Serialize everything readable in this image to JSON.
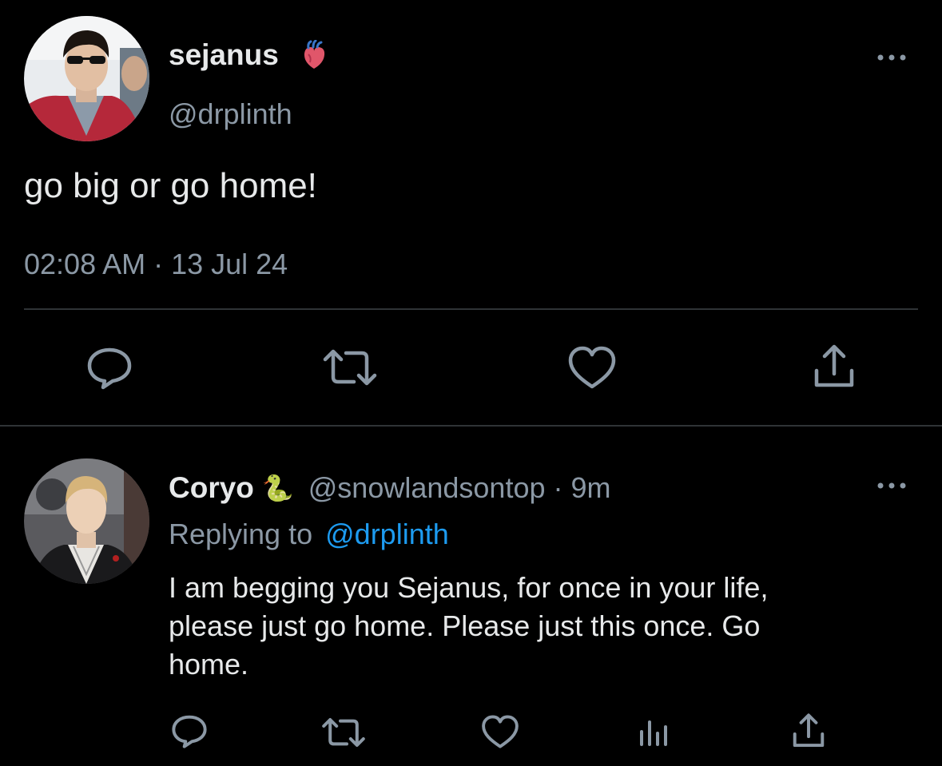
{
  "main_tweet": {
    "display_name": "sejanus",
    "name_emoji": "anatomical-heart",
    "handle": "@drplinth",
    "text": "go big or go home!",
    "timestamp": "02:08 AM · 13 Jul 24",
    "actions": [
      "reply-icon",
      "retweet-icon",
      "like-icon",
      "share-icon"
    ]
  },
  "reply": {
    "display_name": "Coryo",
    "name_emoji": "🐍",
    "handle": "@snowlandsontop",
    "separator": "·",
    "time": "9m",
    "replying_prefix": "Replying to",
    "replying_handle": "@drplinth",
    "text_lines": [
      "I am begging you Sejanus, for once in your life,",
      "please just go home. Please just this once. Go",
      "home."
    ],
    "actions": [
      "reply-icon",
      "retweet-icon",
      "like-icon",
      "analytics-icon",
      "share-icon"
    ]
  },
  "colors": {
    "background": "#000000",
    "primary_text": "#e7e9ea",
    "secondary_text": "#8b98a5",
    "link": "#1d9bf0",
    "divider": "#2f3336"
  }
}
